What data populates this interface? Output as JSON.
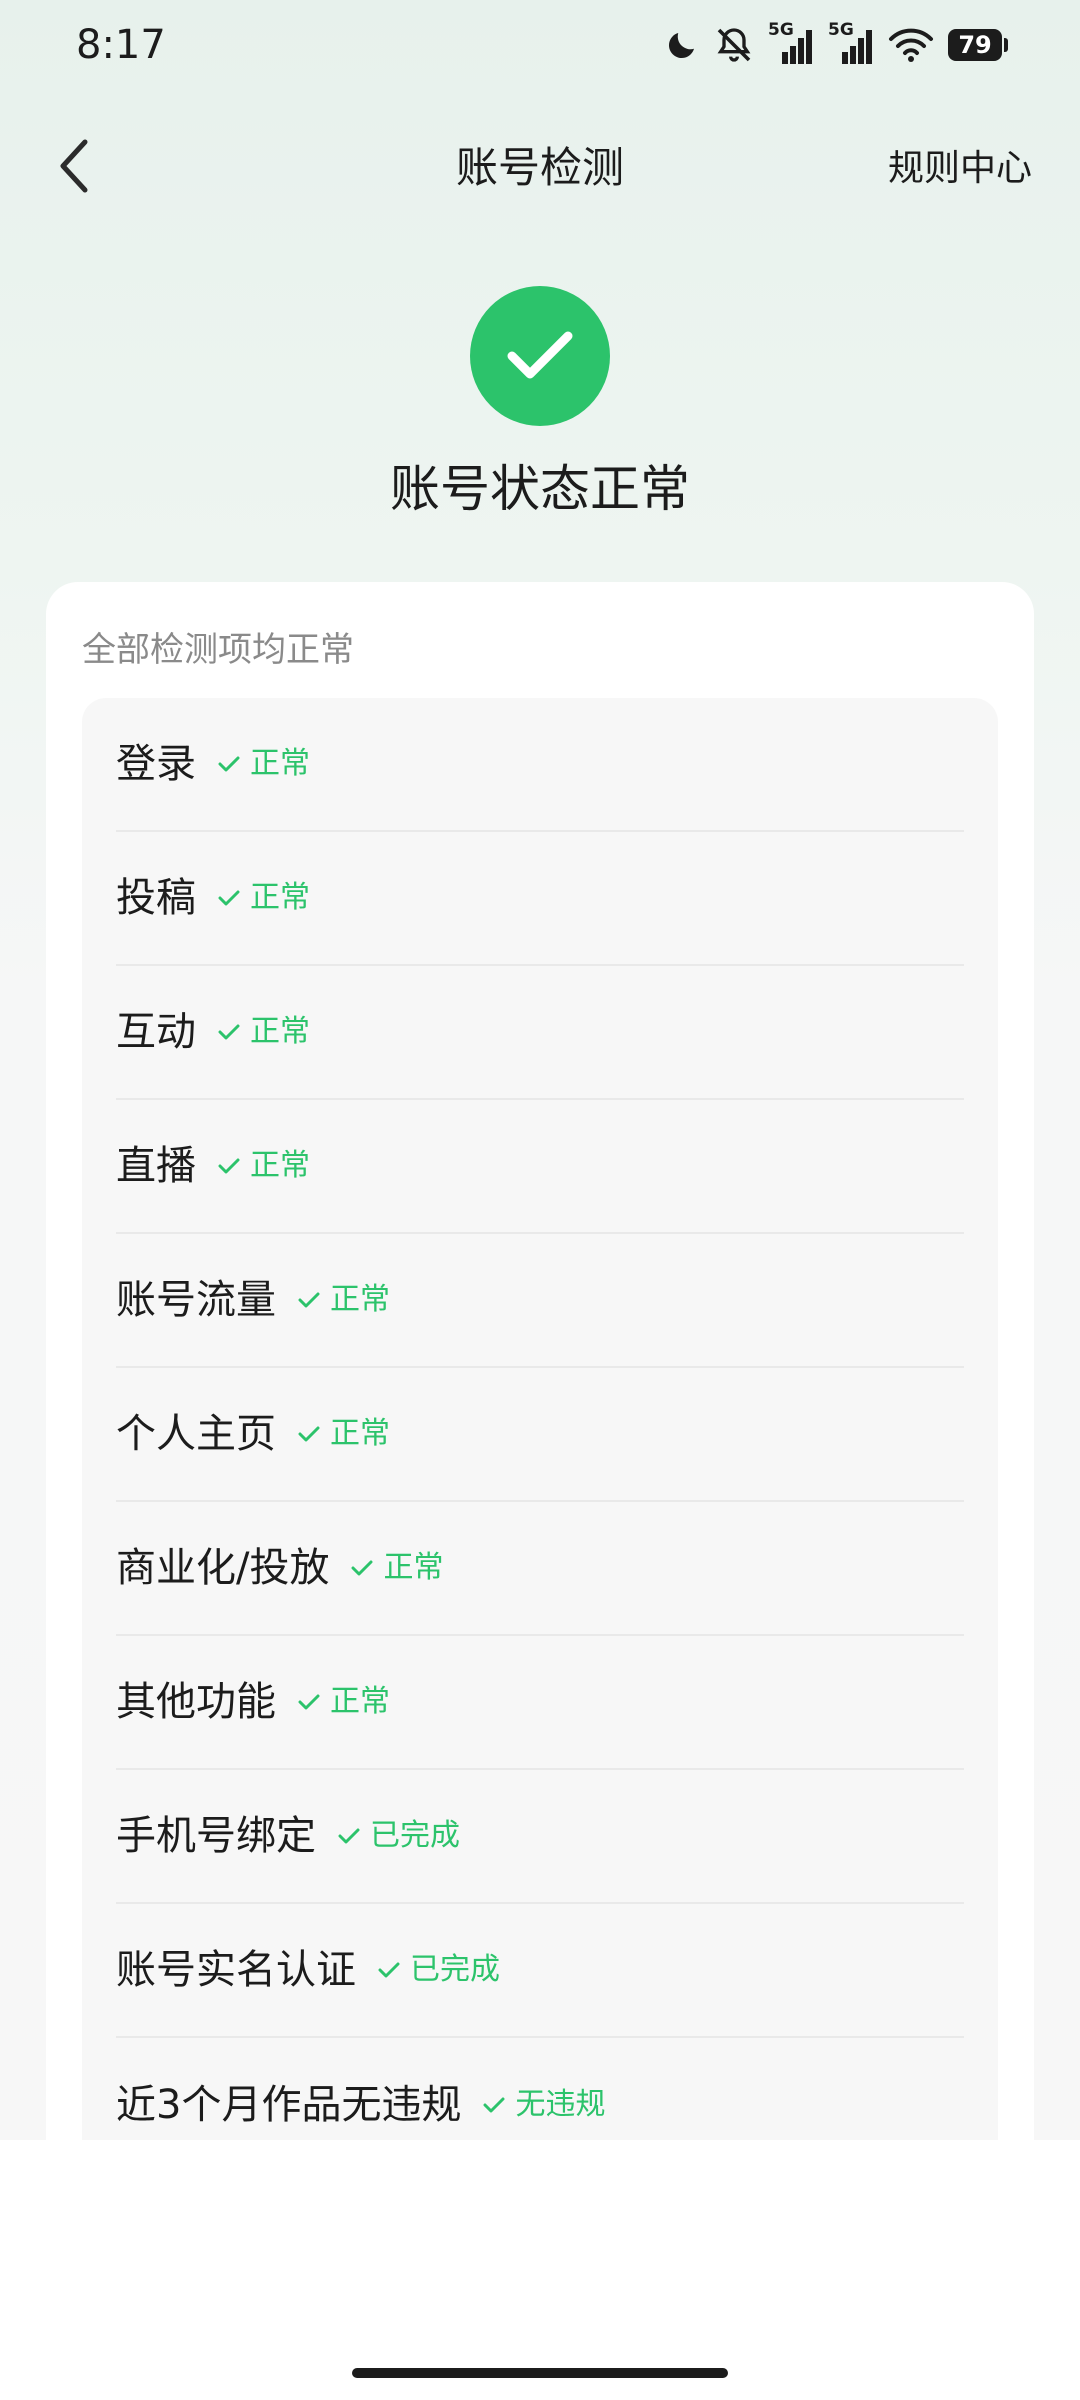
{
  "status_bar": {
    "time": "8:17",
    "signal_1_label": "5G",
    "signal_2_label": "5G",
    "battery": "79",
    "icons": [
      "moon-icon",
      "bell-muted-icon",
      "signal-icon",
      "signal-icon",
      "wifi-icon",
      "battery-icon"
    ]
  },
  "nav": {
    "title": "账号检测",
    "action": "规则中心",
    "back_icon": "chevron-left-icon"
  },
  "hero": {
    "title": "账号状态正常",
    "icon": "check-circle-icon"
  },
  "card": {
    "summary": "全部检测项均正常"
  },
  "checks": [
    {
      "label": "登录",
      "status": "正常"
    },
    {
      "label": "投稿",
      "status": "正常"
    },
    {
      "label": "互动",
      "status": "正常"
    },
    {
      "label": "直播",
      "status": "正常"
    },
    {
      "label": "账号流量",
      "status": "正常"
    },
    {
      "label": "个人主页",
      "status": "正常"
    },
    {
      "label": "商业化/投放",
      "status": "正常"
    },
    {
      "label": "其他功能",
      "status": "正常"
    },
    {
      "label": "手机号绑定",
      "status": "已完成"
    },
    {
      "label": "账号实名认证",
      "status": "已完成"
    },
    {
      "label": "近3个月作品无违规",
      "status": "无违规"
    }
  ],
  "colors": {
    "accent_green": "#2cc36b",
    "text_primary": "#1c1c1c",
    "text_secondary": "#8a8a8a"
  }
}
